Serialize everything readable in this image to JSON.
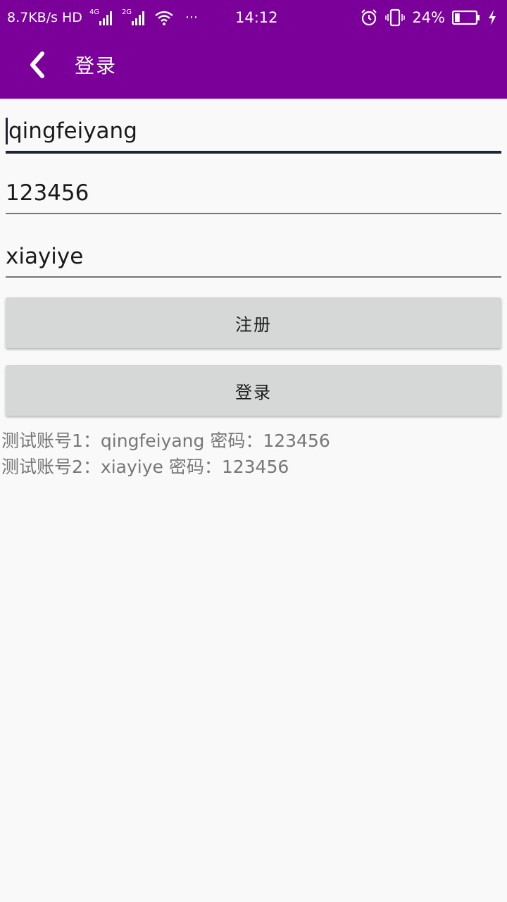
{
  "status_bar": {
    "speed": "8.7KB/s",
    "hd": "HD",
    "net1": "4G",
    "net2": "2G",
    "more": "···",
    "time": "14:12",
    "battery": "24%",
    "battery_level": 0.24,
    "icons": [
      "signal-icon",
      "wifi-icon",
      "alarm-icon",
      "vibrate-icon",
      "battery-icon",
      "charging-icon"
    ]
  },
  "toolbar": {
    "title": "登录",
    "background_color": "#7b0099"
  },
  "form": {
    "username": "qingfeiyang",
    "password": "123456",
    "nickname": "xiayiye",
    "register_label": "注册",
    "login_label": "登录"
  },
  "hints": {
    "line1": "测试账号1：qingfeiyang 密码：123456",
    "line2": "测试账号2：xiayiye 密码：123456"
  }
}
